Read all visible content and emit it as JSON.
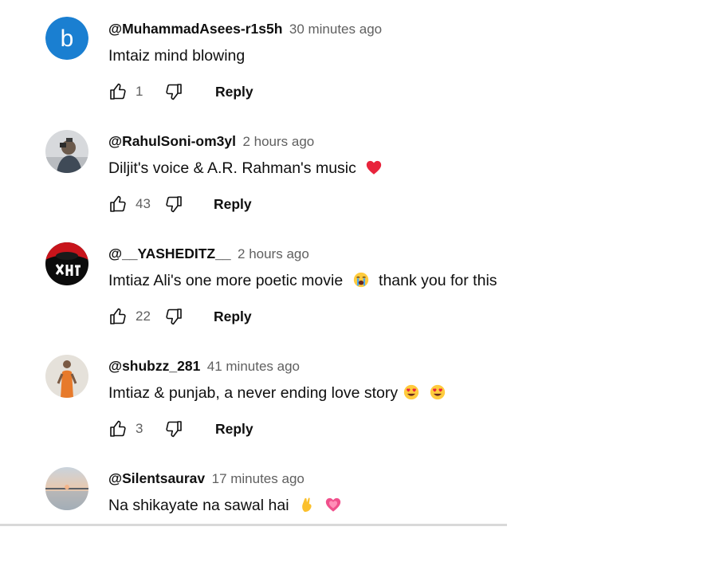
{
  "ui": {
    "reply_label": "Reply",
    "icons": {
      "like": "thumbs-up-outline-icon",
      "dislike": "thumbs-down-outline-icon"
    },
    "colors": {
      "author_text": "#0f0f0f",
      "meta_text": "#606060",
      "avatar_b_bg": "#1a7fd1"
    }
  },
  "comments": [
    {
      "author": "@MuhammadAsees-r1s5h",
      "time": "30 minutes ago",
      "text": "Imtaiz mind blowing",
      "likes": "1",
      "avatar": "letter-b-avatar",
      "avatar_letter": "b"
    },
    {
      "author": "@RahulSoni-om3yl",
      "time": "2 hours ago",
      "text": "Diljit's voice & A.R. Rahman's music",
      "emoji": [
        "red-heart-emoji"
      ],
      "likes": "43",
      "avatar": "person-photo-avatar"
    },
    {
      "author": "@__YASHEDITZ__",
      "time": "2 hours ago",
      "text_before": "Imtiaz Ali's one more poetic movie",
      "text_after": "thank you for this",
      "emoji": [
        "loudly-crying-face-emoji"
      ],
      "likes": "22",
      "avatar": "red-black-logo-avatar"
    },
    {
      "author": "@shubzz_281",
      "time": "41 minutes ago",
      "text": "Imtiaz & punjab, a never ending love story",
      "emoji": [
        "heart-eyes-emoji",
        "heart-eyes-emoji"
      ],
      "likes": "3",
      "avatar": "standing-person-avatar"
    },
    {
      "author": "@Silentsaurav",
      "time": "17 minutes ago",
      "text": "Na shikayate na sawal hai",
      "emoji": [
        "pinched-fingers-emoji",
        "growing-heart-emoji"
      ],
      "avatar": "sunset-lake-avatar"
    }
  ]
}
